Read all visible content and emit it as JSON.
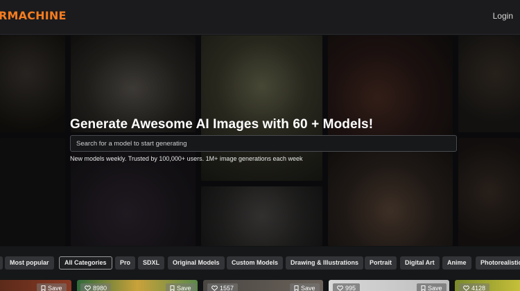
{
  "header": {
    "brand": "RMACHINE",
    "login_label": "Login"
  },
  "hero": {
    "title": "Generate Awesome AI Images with 60 + Models!",
    "search_placeholder": "Search for a model to start generating",
    "tagline": "New models weekly. Trusted by 100,000+ users. 1M+ image generations each week"
  },
  "categories": [
    {
      "label": "Most popular",
      "active": false
    },
    {
      "label": "All Categories",
      "active": true
    },
    {
      "label": "Pro",
      "active": false
    },
    {
      "label": "SDXL",
      "active": false
    },
    {
      "label": "Original Models",
      "active": false
    },
    {
      "label": "Custom Models",
      "active": false
    },
    {
      "label": "Drawing & Illustrations",
      "active": false
    },
    {
      "label": "Portrait",
      "active": false
    },
    {
      "label": "Digital Art",
      "active": false
    },
    {
      "label": "Anime",
      "active": false
    },
    {
      "label": "Photorealistic",
      "active": false
    }
  ],
  "cards": {
    "save_label": "Save",
    "likes": [
      "8980",
      "1557",
      "995",
      "4128"
    ]
  },
  "colors": {
    "brand": "#f57c1f",
    "topbar": "#1b1b1d",
    "chip": "#333437"
  }
}
